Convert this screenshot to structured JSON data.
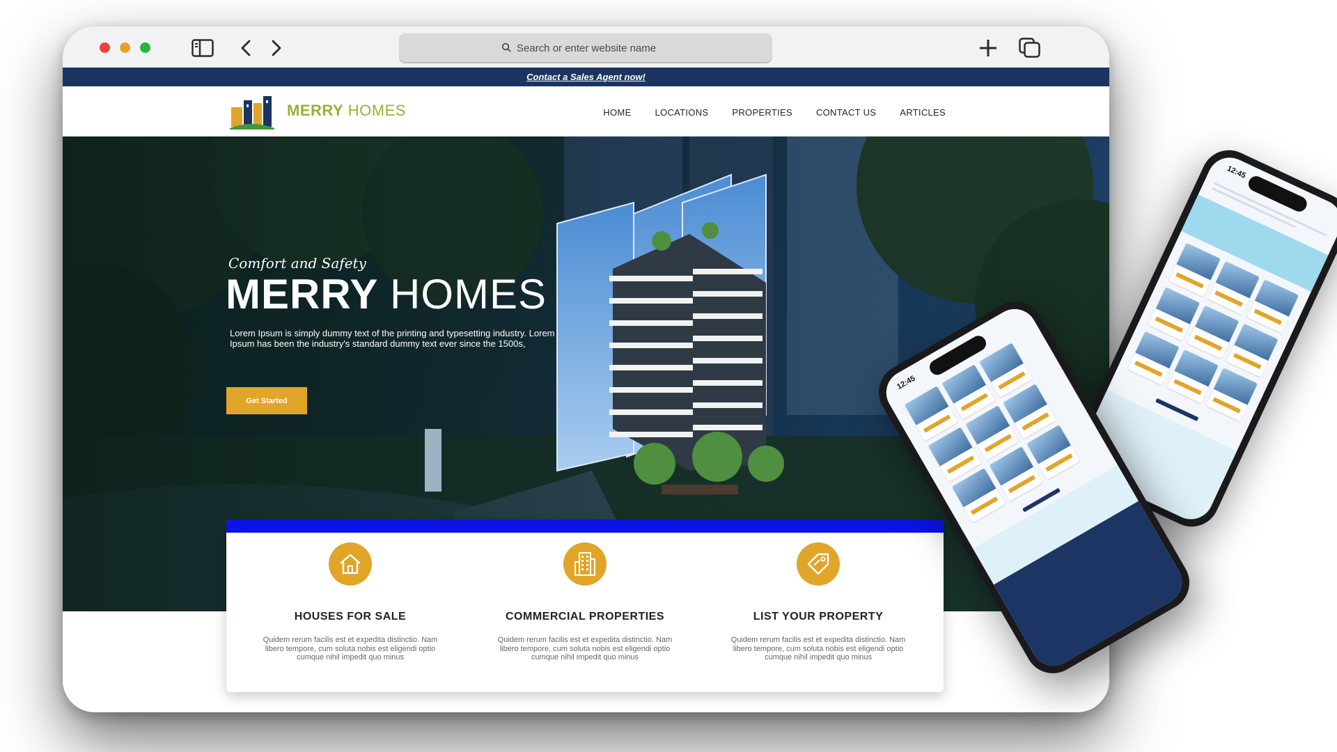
{
  "browser": {
    "address_placeholder": "Search or enter website name"
  },
  "promo": {
    "link_text": "Contact a Sales Agent now!"
  },
  "brand": {
    "name_bold": "MERRY",
    "name_regular": "HOMES"
  },
  "nav": {
    "items": [
      {
        "label": "HOME"
      },
      {
        "label": "LOCATIONS"
      },
      {
        "label": "PROPERTIES"
      },
      {
        "label": "CONTACT US"
      },
      {
        "label": "ARTICLES"
      }
    ]
  },
  "hero": {
    "tagline": "Comfort and Safety",
    "title_bold": "MERRY",
    "title_regular": "HOMES",
    "description": "Lorem Ipsum is simply dummy text of the printing and typesetting industry. Lorem Ipsum has been the industry's standard dummy text ever since the 1500s,",
    "cta_label": "Get Started"
  },
  "features": [
    {
      "title": "HOUSES FOR SALE",
      "text": "Quidem rerum facilis est et expedita distinctio. Nam libero tempore, cum soluta nobis est eligendi optio cumque nihil impedit quo minus",
      "icon": "house-icon"
    },
    {
      "title": "COMMERCIAL PROPERTIES",
      "text": "Quidem rerum facilis est et expedita distinctio. Nam libero tempore, cum soluta nobis est eligendi optio cumque nihil impedit quo minus",
      "icon": "building-icon"
    },
    {
      "title": "LIST YOUR PROPERTY",
      "text": "Quidem rerum facilis est et expedita distinctio. Nam libero tempore, cum soluta nobis est eligendi optio cumque nihil impedit quo minus",
      "icon": "tag-icon"
    }
  ],
  "phones": {
    "time_1": "12:45",
    "time_2": "12:45"
  },
  "colors": {
    "navy": "#1b3560",
    "gold": "#e1a52a",
    "blue_bar": "#0b13e8",
    "logo_green": "#a0ad3a"
  }
}
